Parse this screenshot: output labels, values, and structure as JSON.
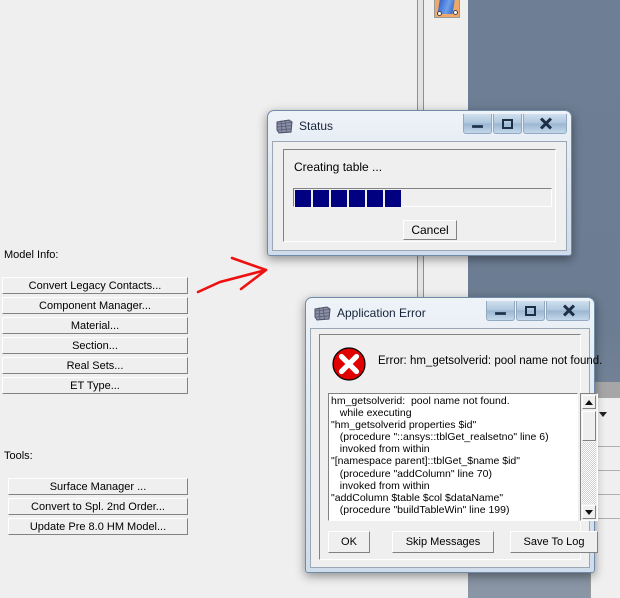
{
  "background": {
    "viewport_color": "#6e7f95",
    "panel_color": "#efefef",
    "toolbar_icon": "surface-mesh-icon"
  },
  "left_panel": {
    "model_info": {
      "label": "Model Info:",
      "buttons": [
        "Convert Legacy Contacts...",
        "Component Manager...",
        "Material...",
        "Section...",
        "Real Sets...",
        "ET Type..."
      ]
    },
    "tools": {
      "label": "Tools:",
      "buttons": [
        "Surface Manager ...",
        "Convert to Spl. 2nd Order...",
        "Update Pre 8.0 HM Model..."
      ]
    }
  },
  "annotation": {
    "type": "red-arrow",
    "color": "#ee1111",
    "points_to": "Component Manager... button"
  },
  "status_dialog": {
    "title": "Status",
    "icon": "mesh-icon",
    "message": "Creating table ...",
    "progress": {
      "blocks": 6,
      "block_color": "#000080",
      "percent": 38
    },
    "cancel_label": "Cancel",
    "window_buttons": [
      "minimize",
      "maximize",
      "close"
    ]
  },
  "error_dialog": {
    "title": "Application Error",
    "icon": "mesh-icon",
    "error_icon": "error-circle-x-icon",
    "error_icon_color": "#e00000",
    "headline": "Error: hm_getsolverid:  pool name not found.",
    "trace": "hm_getsolverid:  pool name not found.\n   while executing\n\"hm_getsolverid properties $id\"\n   (procedure \"::ansys::tblGet_realsetno\" line 6)\n   invoked from within\n\"[namespace parent]::tblGet_$name $id\"\n   (procedure \"addColumn\" line 70)\n   invoked from within\n\"addColumn $table $col $dataName\"\n   (procedure \"buildTableWin\" line 199)",
    "buttons": {
      "ok": "OK",
      "skip": "Skip Messages",
      "save": "Save To Log"
    },
    "window_buttons": [
      "minimize",
      "maximize",
      "close"
    ]
  }
}
